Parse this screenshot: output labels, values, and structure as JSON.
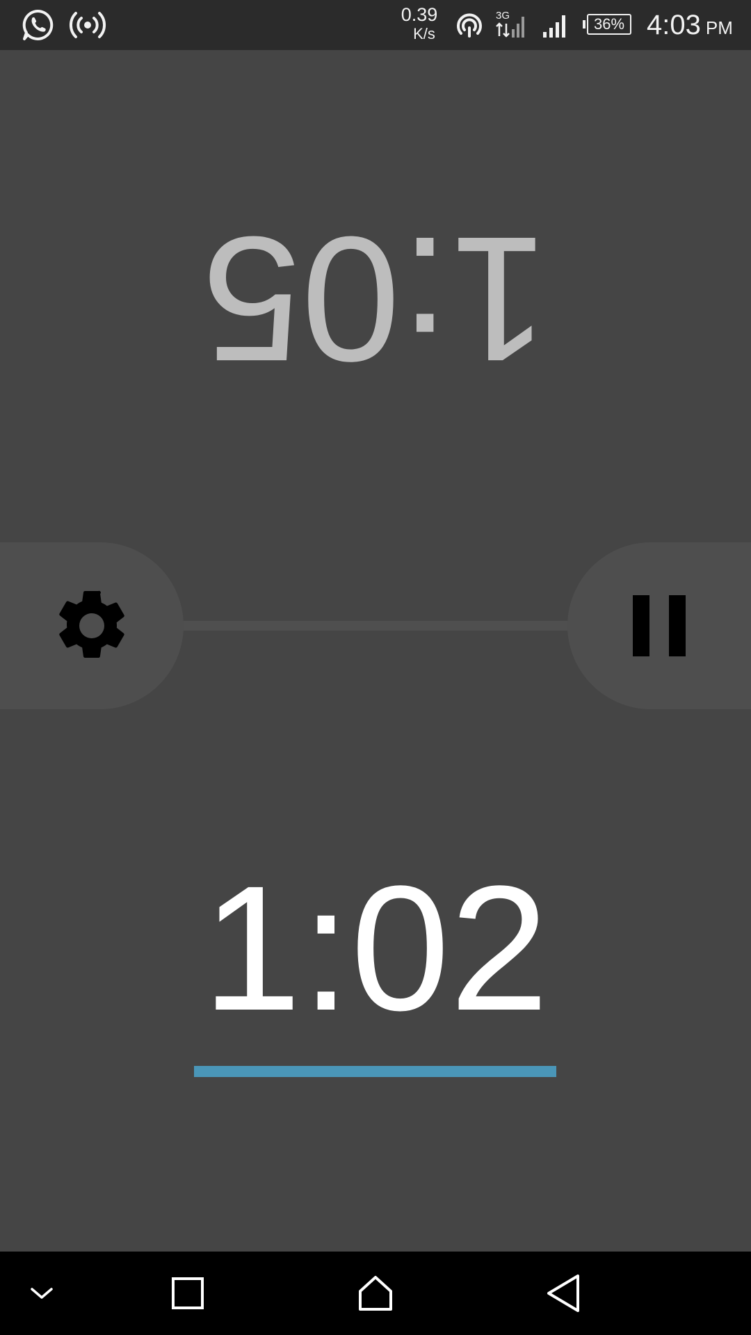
{
  "status_bar": {
    "icons": [
      "whatsapp-icon",
      "broadcast-icon",
      "hotspot-icon",
      "3g-data-icon",
      "cell-signal-icon",
      "battery-icon"
    ],
    "net_speed_value": "0.39",
    "net_speed_unit": "K/s",
    "battery_percent": "36%",
    "time": "4:03",
    "ampm": "PM"
  },
  "timers": {
    "top_player": "1:05",
    "bottom_player": "1:02"
  },
  "controls": {
    "settings_icon": "gear-icon",
    "pause_icon": "pause-icon"
  },
  "progress": {
    "fraction": 1.0,
    "color": "#4a96b8"
  },
  "nav_bar": {
    "buttons": [
      "collapse-icon",
      "recents-icon",
      "home-icon",
      "back-icon"
    ]
  },
  "colors": {
    "background": "#454545",
    "status_bar": "#2b2b2b",
    "control_pill": "#4e4e4e",
    "top_timer_text": "#bdbdbd",
    "bottom_timer_text": "#ffffff",
    "nav_bar": "#000000"
  }
}
